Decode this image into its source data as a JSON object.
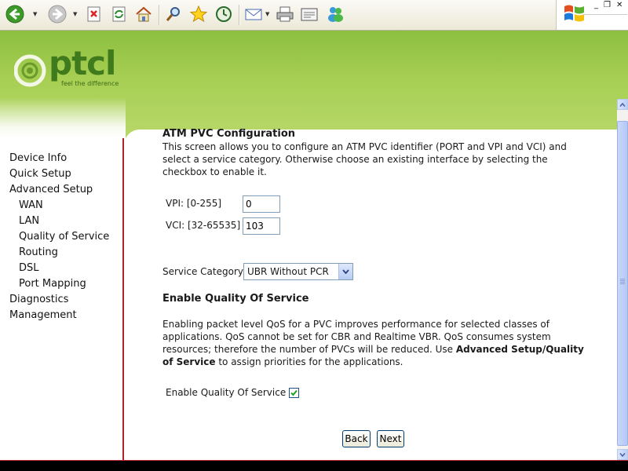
{
  "browser": {
    "window_controls": {
      "minimize": "_",
      "restore": "❐",
      "close": "✕"
    }
  },
  "brand": {
    "name": "ptcl",
    "tagline": "feel the difference",
    "accent_green": "#8cbf3f",
    "accent_red": "#b0232d"
  },
  "nav": {
    "items": [
      {
        "label": "Device Info",
        "level": 0
      },
      {
        "label": "Quick Setup",
        "level": 0
      },
      {
        "label": "Advanced Setup",
        "level": 0
      },
      {
        "label": "WAN",
        "level": 1
      },
      {
        "label": "LAN",
        "level": 1
      },
      {
        "label": "Quality of Service",
        "level": 1
      },
      {
        "label": "Routing",
        "level": 1
      },
      {
        "label": "DSL",
        "level": 1
      },
      {
        "label": "Port Mapping",
        "level": 1
      },
      {
        "label": "Diagnostics",
        "level": 0
      },
      {
        "label": "Management",
        "level": 0
      }
    ]
  },
  "page": {
    "title": "ATM PVC Configuration",
    "description": "This screen allows you to configure an ATM PVC identifier (PORT and VPI and VCI) and select a service category. Otherwise choose an existing interface by selecting the checkbox to enable it.",
    "vpi_label": "VPI: [0-255]",
    "vpi_value": "0",
    "vci_label": "VCI: [32-65535]",
    "vci_value": "103",
    "service_category_label": "Service Category:",
    "service_category_value": "UBR Without PCR",
    "qos_heading": "Enable Quality Of Service",
    "qos_text_1": "Enabling packet level QoS for a PVC improves performance for selected classes of applications.  QoS cannot be set for CBR and Realtime VBR.  QoS consumes system resources; therefore the number of PVCs will be reduced. Use ",
    "qos_text_bold": "Advanced Setup/Quality of Service",
    "qos_text_2": " to assign priorities for the applications.",
    "qos_checkbox_label": "Enable Quality Of Service",
    "qos_checked": true,
    "back_label": "Back",
    "next_label": "Next"
  }
}
